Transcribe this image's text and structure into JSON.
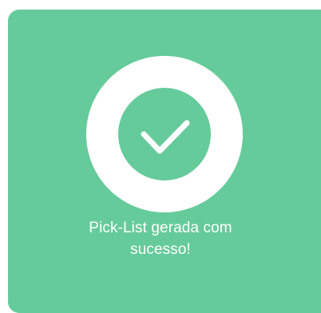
{
  "dialog": {
    "message_line1": "Pick-List gerada com",
    "message_line2": "sucesso!",
    "icon": "check-circle-icon"
  },
  "colors": {
    "background": "#66cb9a",
    "ring": "#ffffff",
    "check": "#ffffff"
  }
}
